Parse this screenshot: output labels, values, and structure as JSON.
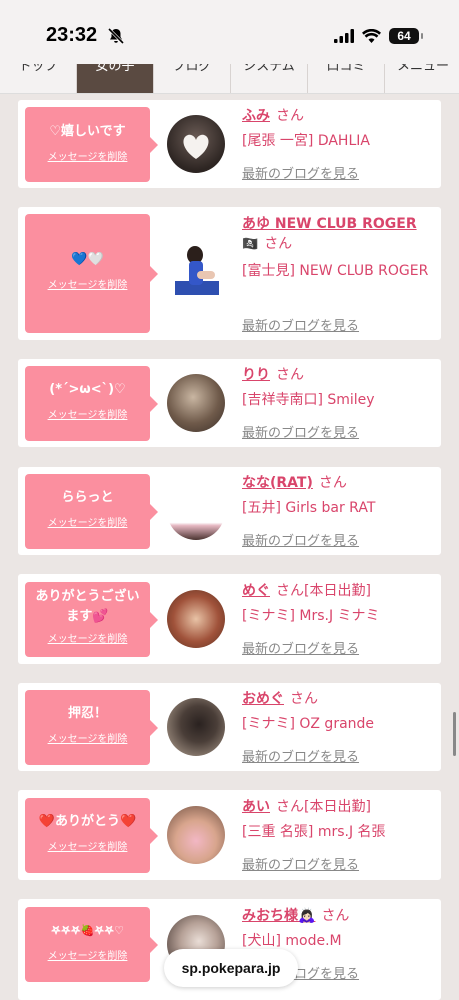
{
  "status": {
    "time": "23:32",
    "battery": "64"
  },
  "tabs": [
    "トップ",
    "女の子",
    "ブログ",
    "システム",
    "口コミ",
    "メニュー"
  ],
  "delete_label": "メッセージを削除",
  "blog_label": "最新のブログを見る",
  "san": "さん",
  "cards": [
    {
      "message": "♡嬉しいです",
      "name": "ふみ",
      "extra": "",
      "shop": "[尾張 一宮] DAHLIA"
    },
    {
      "message": "💙🤍",
      "name": "あゆ NEW CLUB ROGER",
      "name_icon": "🏴‍☠️",
      "extra": "",
      "shop": "[富士見] NEW CLUB ROGER"
    },
    {
      "message": "(*´>ω<`)♡",
      "name": "りり",
      "extra": "",
      "shop": "[吉祥寺南口] Smiley"
    },
    {
      "message": "ららっと",
      "name": "なな(RAT)",
      "extra": "",
      "shop": "[五井] Girls bar RAT"
    },
    {
      "message": "ありがとうございます💕",
      "name": "めぐ",
      "extra": "[本日出勤]",
      "shop": "[ミナミ] Mrs.J ミナミ"
    },
    {
      "message": "押忍！",
      "name": "おめぐ",
      "extra": "",
      "shop": "[ミナミ] OZ grande"
    },
    {
      "message": "❤️ありがとう❤️",
      "name": "あい",
      "extra": "[本日出勤]",
      "shop": "[三重 名張] mrs.J 名張"
    },
    {
      "message": "𖤐𖤐𖤐🍓𖤐𖤐♡",
      "name": "みおち様🙇🏻‍♀️",
      "extra": "",
      "shop": "[犬山] mode.M"
    }
  ],
  "url": "sp.pokepara.jp",
  "colors": {
    "accent": "#d9456b",
    "bubble": "#fb8f9f",
    "tab_active": "#5a4a41"
  }
}
